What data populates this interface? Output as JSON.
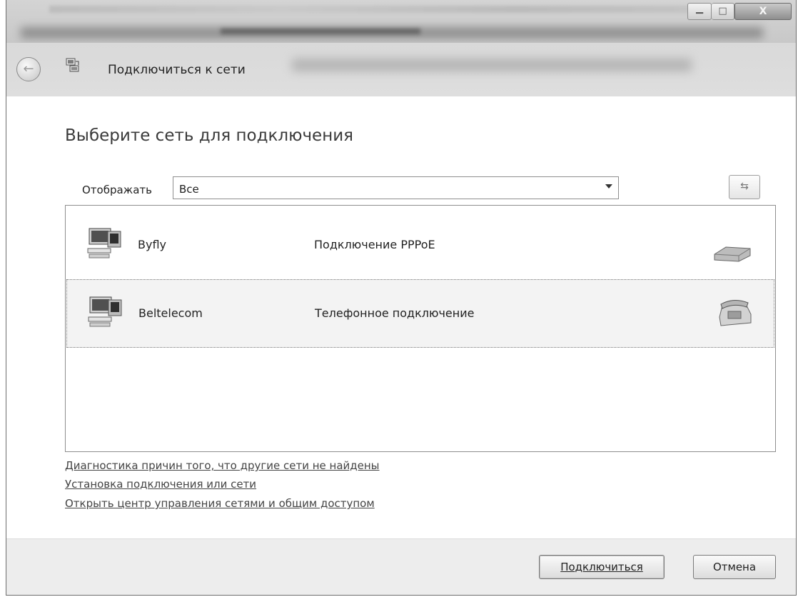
{
  "window": {
    "title_glyphs": {
      "minimize": "▁",
      "maximize": "□",
      "close": "X"
    }
  },
  "nav": {
    "title": "Подключиться к сети",
    "back_glyph": "←"
  },
  "main": {
    "heading": "Выберите сеть для подключения",
    "filter": {
      "label": "Отображать",
      "value": "Все"
    },
    "refresh_glyph": "⇆",
    "networks": [
      {
        "name": "Byfly",
        "type": "Подключение PPPoE",
        "icon": "pppoe-modem-icon"
      },
      {
        "name": "Beltelecom",
        "type": "Телефонное подключение",
        "icon": "dialup-phone-icon",
        "selected": true
      }
    ],
    "links": [
      "Диагностика причин того, что другие сети не найдены",
      "Установка подключения или сети",
      "Открыть центр управления сетями и общим доступом"
    ]
  },
  "footer": {
    "connect_label": "Подключиться",
    "cancel_label": "Отмена"
  }
}
